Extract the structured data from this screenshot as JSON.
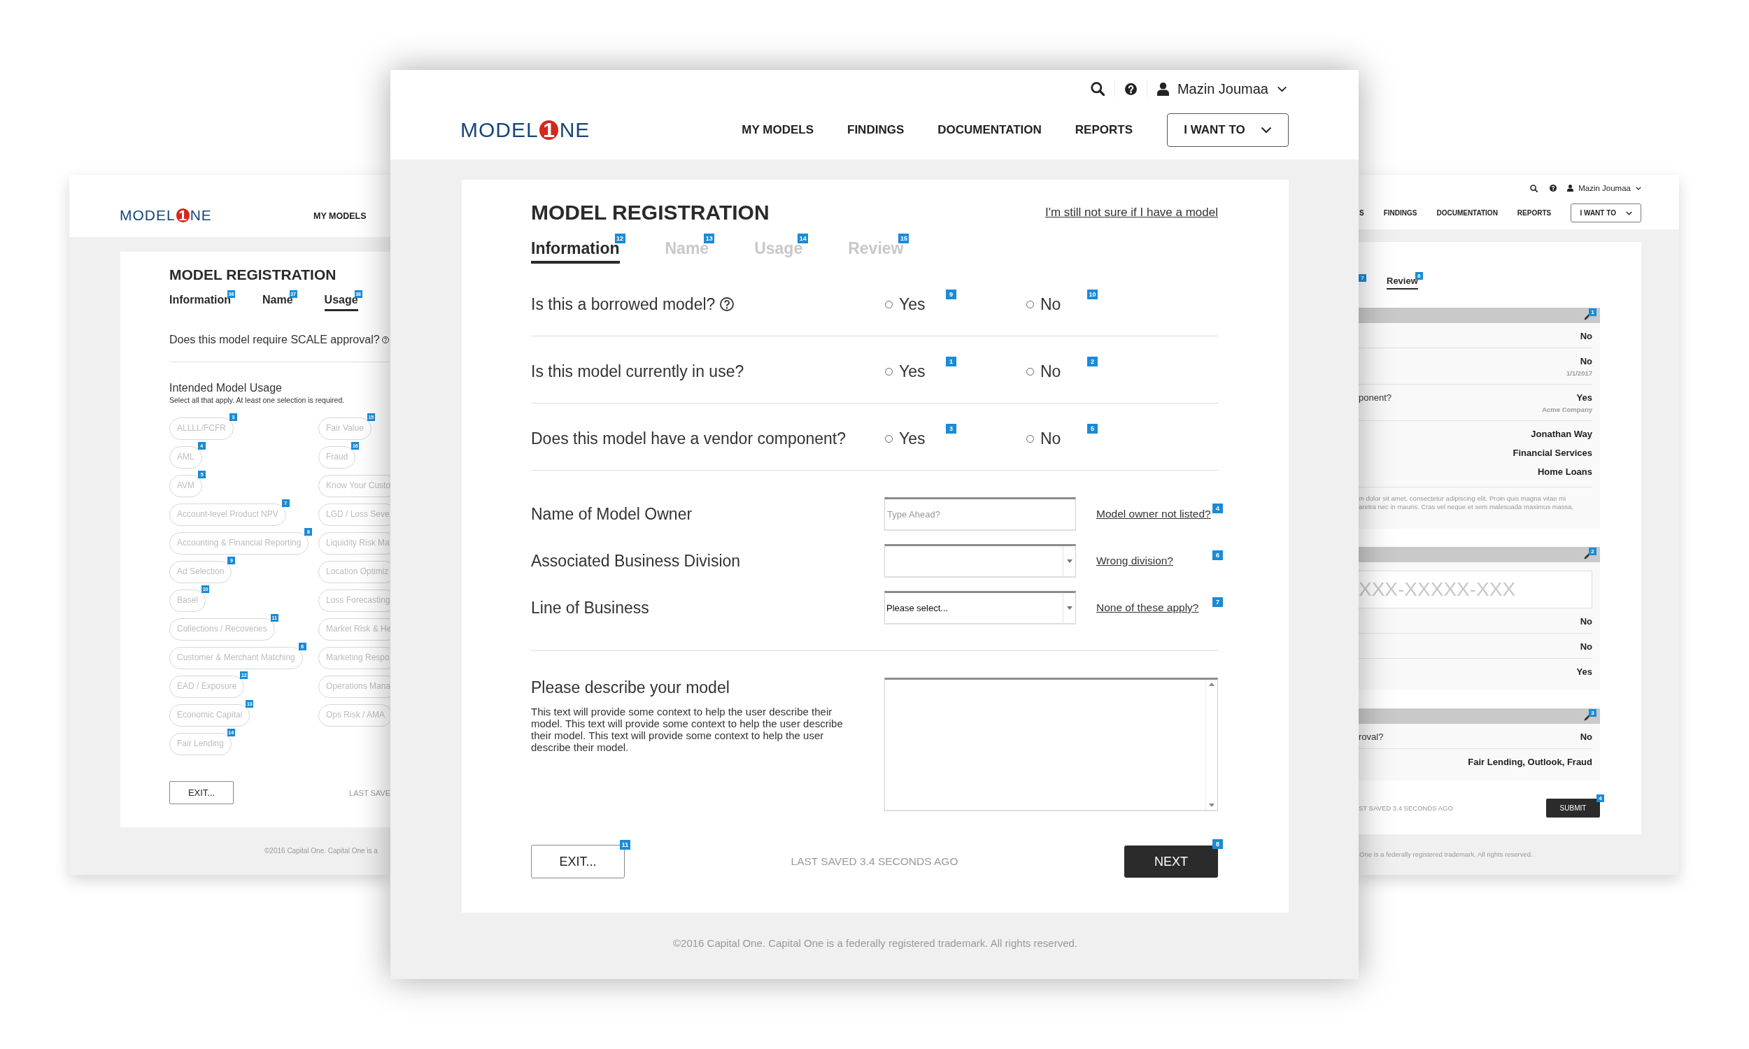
{
  "main_window": {
    "header": {
      "logo": {
        "text_before": "MODEL",
        "mark": "1",
        "text_after": "NE"
      },
      "user": "Mazin Joumaa",
      "nav": [
        {
          "label": "MY MODELS"
        },
        {
          "label": "FINDINGS"
        },
        {
          "label": "DOCUMENTATION"
        },
        {
          "label": "REPORTS"
        }
      ],
      "menu_button": "I WANT TO"
    },
    "title": "MODEL REGISTRATION",
    "help_link": "I'm still not sure if I have a model",
    "tabs": [
      {
        "label": "Information",
        "selected": true,
        "disabled": false,
        "badge": "12"
      },
      {
        "label": "Name",
        "selected": false,
        "disabled": true,
        "badge": "13"
      },
      {
        "label": "Usage",
        "selected": false,
        "disabled": true,
        "badge": "14"
      },
      {
        "label": "Review",
        "selected": false,
        "disabled": true,
        "badge": "15"
      }
    ],
    "questions": [
      {
        "text": "Is this a borrowed model?",
        "help": true,
        "options": [
          {
            "label": "Yes",
            "selected": false,
            "badge": "9"
          },
          {
            "label": "No",
            "selected": false,
            "badge": "10"
          }
        ]
      },
      {
        "text": "Is this model currently in use?",
        "help": false,
        "options": [
          {
            "label": "Yes",
            "selected": false,
            "badge": "1"
          },
          {
            "label": "No",
            "selected": false,
            "badge": "2"
          }
        ]
      },
      {
        "text": "Does this model have a vendor component?",
        "help": false,
        "options": [
          {
            "label": "Yes",
            "selected": false,
            "badge": "3"
          },
          {
            "label": "No",
            "selected": false,
            "badge": "5"
          }
        ]
      }
    ],
    "fields": [
      {
        "kind": "text",
        "label": "Name of Model Owner",
        "placeholder": "Type Ahead?",
        "link": "Model owner not listed?",
        "badge": "4"
      },
      {
        "kind": "select",
        "label": "Associated Business Division",
        "link": "Wrong division?",
        "badge": "6"
      },
      {
        "kind": "select",
        "label": "Line of Business",
        "value": "Please select...",
        "link": "None of these apply?",
        "badge": "7"
      }
    ],
    "description": {
      "label": "Please describe your model",
      "hint": "This text will provide some context to help the user describe their model. This text will provide some context to help the user describe their model. This text will provide some context to help the user describe their model."
    },
    "footer": {
      "exit": {
        "label": "EXIT...",
        "badge": "11"
      },
      "status": "LAST SAVED 3.4 SECONDS AGO",
      "next": {
        "label": "NEXT",
        "badge": "8"
      }
    },
    "copyright": "©2016 Capital One. Capital One is a federally registered trademark. All rights reserved."
  },
  "left_window": {
    "logo": {
      "text_before": "MODEL",
      "mark": "1",
      "text_after": "NE"
    },
    "nav": [
      {
        "label": "MY MODELS"
      }
    ],
    "title": "MODEL REGISTRATION",
    "tabs": [
      {
        "label": "Information",
        "selected": false,
        "disabled": false,
        "badge": "36"
      },
      {
        "label": "Name",
        "selected": false,
        "disabled": false,
        "badge": "37"
      },
      {
        "label": "Usage",
        "selected": true,
        "disabled": false,
        "badge": "38"
      }
    ],
    "question": {
      "text": "Does this model require SCALE approval?",
      "help": true
    },
    "usage": {
      "title": "Intended Model Usage",
      "hint": "Select all that apply. At least one selection is required.",
      "columns": [
        [
          {
            "label": "ALLLL/FCFR",
            "selected": false,
            "badge": "3"
          },
          {
            "label": "AML",
            "selected": false,
            "badge": "4"
          },
          {
            "label": "AVM",
            "selected": false,
            "badge": "5"
          },
          {
            "label": "Account-level Product NPV",
            "selected": false,
            "badge": "7"
          },
          {
            "label": "Accounting & Financial Reporting",
            "selected": false,
            "badge": "8"
          },
          {
            "label": "Ad Selection",
            "selected": false,
            "badge": "9"
          },
          {
            "label": "Basel",
            "selected": false,
            "badge": "10"
          },
          {
            "label": "Collections / Recoveries",
            "selected": false,
            "badge": "11"
          },
          {
            "label": "Customer & Merchant Matching",
            "selected": false,
            "badge": "6"
          },
          {
            "label": "EAD / Exposure",
            "selected": false,
            "badge": "12"
          },
          {
            "label": "Economic Capital",
            "selected": false,
            "badge": "13"
          },
          {
            "label": "Fair Lending",
            "selected": false,
            "badge": "14"
          }
        ],
        [
          {
            "label": "Fair Value",
            "selected": false,
            "badge": "15"
          },
          {
            "label": "Fraud",
            "selected": false,
            "badge": "16"
          },
          {
            "label": "Know Your Custo",
            "selected": false
          },
          {
            "label": "LGD / Loss Seve",
            "selected": false
          },
          {
            "label": "Liquidity Risk Ma",
            "selected": false
          },
          {
            "label": "Location Optimiz",
            "selected": false
          },
          {
            "label": "Loss Forecasting",
            "selected": false
          },
          {
            "label": "Market Risk & He",
            "selected": false
          },
          {
            "label": "Marketing Respo",
            "selected": false
          },
          {
            "label": "Operations Mana",
            "selected": false
          },
          {
            "label": "Ops Risk / AMA",
            "selected": false
          }
        ]
      ]
    },
    "footer": {
      "exit": "EXIT...",
      "status": "LAST SAVE"
    },
    "copyright": "©2016 Capital One. Capital One is a"
  },
  "right_window": {
    "header": {
      "user": "Mazin Joumaa",
      "nav": [
        {
          "label": "S"
        },
        {
          "label": "FINDINGS"
        },
        {
          "label": "DOCUMENTATION"
        },
        {
          "label": "REPORTS"
        }
      ],
      "menu_button": "I WANT TO"
    },
    "cut_badge": "7",
    "tabs": [
      {
        "label": "Review",
        "selected": true,
        "badge": "8"
      }
    ],
    "sections": [
      {
        "badge": "1",
        "rows": [
          {
            "kind": "value",
            "value": "No"
          },
          {
            "kind": "value",
            "value": "No",
            "note": "1/1/2017"
          },
          {
            "kind": "value",
            "label": "ponent?",
            "value": "Yes",
            "note": "Acme Company"
          },
          {
            "kind": "list",
            "values": [
              "Jonathan Way",
              "Financial Services",
              "Home Loans"
            ]
          },
          {
            "kind": "paragraph",
            "lines": [
              "m dolor sit amet, consectetur adipiscing elit. Proin quis magna vitae mi",
              "aretra nec in mauris. Cras vel neque et sem malesuada maximus massa."
            ]
          }
        ]
      },
      {
        "badge": "2",
        "rows": [
          {
            "kind": "field",
            "placeholder": "XXX-XXXXX-XXX"
          },
          {
            "kind": "value",
            "value": "No"
          },
          {
            "kind": "value",
            "value": "No"
          },
          {
            "kind": "value",
            "value": "Yes"
          }
        ]
      },
      {
        "badge": "3",
        "rows": [
          {
            "kind": "value",
            "label": "roval?",
            "value": "No"
          },
          {
            "kind": "value",
            "value": "Fair Lending, Outlook, Fraud"
          }
        ]
      }
    ],
    "footer": {
      "status": "ST SAVED 3.4 SECONDS AGO",
      "submit": {
        "label": "SUBMIT",
        "badge": "4"
      }
    },
    "copyright": "One is a federally registered trademark. All rights reserved."
  }
}
